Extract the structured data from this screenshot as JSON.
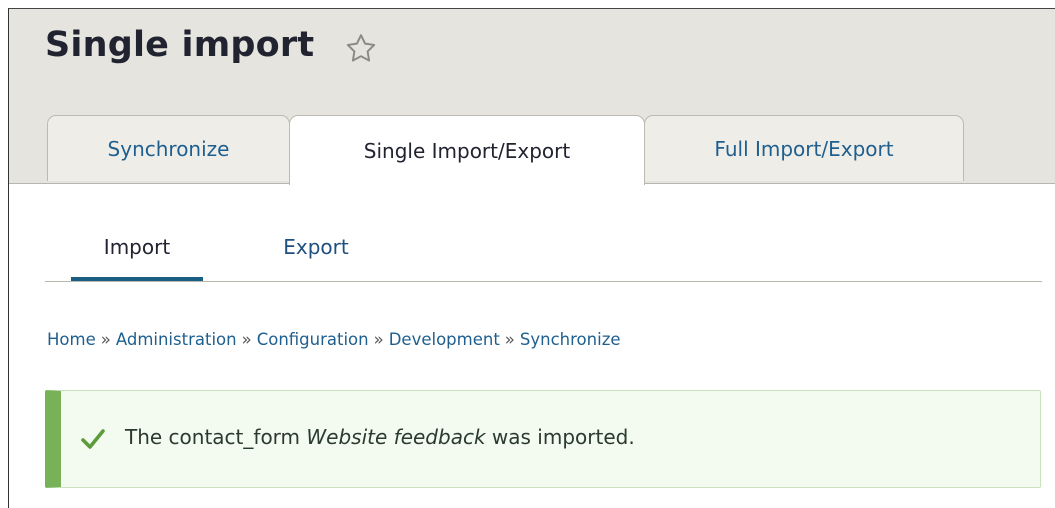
{
  "header": {
    "title": "Single import",
    "star_icon": "star-outline-icon"
  },
  "tabs": [
    {
      "label": "Synchronize",
      "active": false
    },
    {
      "label": "Single Import/Export",
      "active": true
    },
    {
      "label": "Full Import/Export",
      "active": false
    }
  ],
  "subtabs": [
    {
      "label": "Import",
      "active": true
    },
    {
      "label": "Export",
      "active": false
    }
  ],
  "breadcrumb": {
    "separator": "»",
    "items": [
      "Home",
      "Administration",
      "Configuration",
      "Development",
      "Synchronize"
    ]
  },
  "message": {
    "icon": "checkmark-icon",
    "prefix": "The contact_form ",
    "emphasis": "Website feedback",
    "suffix": " was imported.",
    "status_color": "#77b259"
  },
  "colors": {
    "header_bg": "#e5e4df",
    "link": "#1f5f8f",
    "active_subtab": "#1b5e83"
  }
}
